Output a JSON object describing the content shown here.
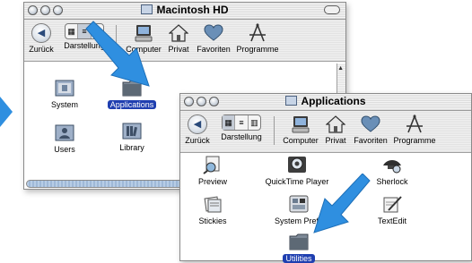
{
  "back_window": {
    "title": "Macintosh HD",
    "toolbar": [
      "Zurück",
      "Darstellung",
      "Computer",
      "Privat",
      "Favoriten",
      "Programme"
    ],
    "items": [
      {
        "label": "System",
        "icon": "system-folder-icon",
        "selected": false
      },
      {
        "label": "Applications",
        "icon": "folder-icon",
        "selected": true
      },
      {
        "label": "Users",
        "icon": "users-folder-icon",
        "selected": false
      },
      {
        "label": "Library",
        "icon": "library-folder-icon",
        "selected": false
      }
    ]
  },
  "front_window": {
    "title": "Applications",
    "toolbar": [
      "Zurück",
      "Darstellung",
      "Computer",
      "Privat",
      "Favoriten",
      "Programme"
    ],
    "items": [
      {
        "label": "Preview",
        "icon": "preview-app-icon"
      },
      {
        "label": "QuickTime Player",
        "icon": "quicktime-app-icon"
      },
      {
        "label": "Sherlock",
        "icon": "sherlock-app-icon"
      },
      {
        "label": "Stickies",
        "icon": "stickies-app-icon"
      },
      {
        "label": "System Prefe",
        "icon": "system-preferences-app-icon"
      },
      {
        "label": "TextEdit",
        "icon": "textedit-app-icon"
      },
      {
        "label": "Utilities",
        "icon": "folder-icon",
        "selected": true
      }
    ]
  },
  "colors": {
    "arrow": "#2f8fe0",
    "selection": "#1f3fb0",
    "scroll": "#9fb9d8"
  }
}
